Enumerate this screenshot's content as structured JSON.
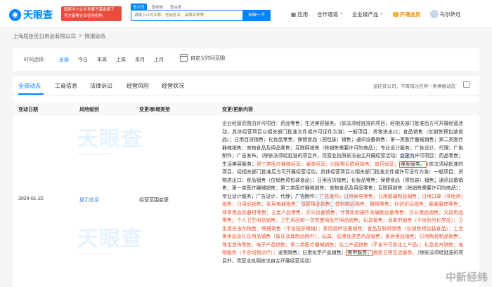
{
  "header": {
    "logo_text": "天眼查",
    "logo_sub": "TianYancha.com",
    "promo_line1": "国家中小企业发展子基金旗下",
    "promo_line2": "官方备案企业征信机构",
    "search_tabs": [
      "查公司",
      "查老板",
      "查关系"
    ],
    "search_placeholder": "请输入公司名称、老板姓名、品牌名称等",
    "search_button": "天眼一下",
    "nav": {
      "app": "应用",
      "partner": "合作通道",
      "enterprise": "企业级产品",
      "vip": "开通会员",
      "user": "乌尔萨月"
    }
  },
  "breadcrumb": [
    "上海屈臣氏日用品有限公司",
    ">",
    "情报动态"
  ],
  "filter": {
    "label": "时间选择:",
    "options": [
      "全部",
      "今日",
      "本周",
      "上周",
      "本月",
      "上月"
    ],
    "active": "全部",
    "custom_range": "自定义时间范围"
  },
  "tabs": [
    {
      "label": "全部动态",
      "active": true
    },
    {
      "label": "工商信息",
      "active": false
    },
    {
      "label": "法律诉讼",
      "active": false
    },
    {
      "label": "经营风险",
      "active": false
    },
    {
      "label": "经营状况",
      "active": false
    }
  ],
  "monitor_text": "监控该公司，不再错过任何一条情报动态",
  "table": {
    "headers": [
      "变动日期",
      "风险级别",
      "变更/新增类型",
      "变更/更新内容"
    ],
    "row": {
      "date": "2024-01-22",
      "risk": "提示信息",
      "type": "经营范围变更",
      "seg1": "企业经营范围由许可项目：药品零售；生活美容服务。（依法须经批准的项目，经相关部门批准后方可开展经营活动，具体经营项目以相关部门批准文件或许可证件为准）一般项目：货物进出口；食品销售（仅销售预包装食品）；日用百货销售；化妆品零售；保健食品（预包装）销售；通讯设备销售；第一类医疗器械销售；第二类医疗器械销售；宠物食品及用品零售；互联网销售（除销售需要许可的商品）；专业设计服务；广告设计、代理；广告制作；广告发布。（除依法须经批准的项目外，凭营业执照依法自主开展经营活动）",
      "changed_to": "变更为",
      "seg2": "许可项目：药品零售；生活美容服务；",
      "hl1": "第三类医疗器械经营；酒类经营；出版物互联网销售；兽药经营；",
      "boxed1": "理发服务。",
      "seg3": "（依法须经批准的项目，经相关部门批准后方可开展经营活动，具体经营项目以相关部门批准文件或许可证件为准）一般项目：货物进出口；食品销售（仅销售预包装食品）；日用百货销售；化妆品零售；保健食品（预包装）销售；通讯设备销售；第一类医疗器械销售；第二类医疗器械销售；宠物食品及用品零售；互联网销售（除销售需要许可的商品）；专业设计服务；广告设计、代理；广告制作；",
      "seg4": "广告发布；",
      "hl2": "日用家电零售；日用玻璃制品销售；日用口罩（非医用）销售；日用品销售；家用电器销售；母婴用品销售；塑料制品销售；鞋帽零售；针纺织品销售；服装服饰零售；体育用品及器材零售；五金产品零售；办公设备销售；计算机软硬件及辅助设备零售；办公用品销售；文具用品零售；个人卫生用品销售；卫生用品和一次性使用医疗用品销售；玩具销售；消毒剂销售（不含危险化学品）；卫生用杀虫剂销售；眼镜销售（不含隐形眼镜）；家用视听设备销售；食品互联网销售（仅销售预包装食品）；工艺美术品及礼仪用品销售（象牙及其制品除外）；玩具、动漫及游艺用品销售；家居用品销售；日用陶瓷制品销售；珠宝首饰零售；电子产品销售；第二类医疗器械销售；化工产品销售（不含许可类化工产品）；礼品花卉销售；宠物服务（不含动物诊疗）；",
      "seg5": "宠物销售；日用化学产品销售；",
      "boxed2": "美甲服务；",
      "hl3": "居民日常生活服务。",
      "seg6": "（除依法须经批准的项目外，凭营业执照依法自主开展经营活动）"
    }
  },
  "watermark": {
    "text": "天眼查",
    "sub": "TianYancha.com",
    "corner": "中新经纬"
  },
  "colors": {
    "brand": "#0084ff",
    "highlight": "#e8502c",
    "promo": "#e84d3d"
  }
}
